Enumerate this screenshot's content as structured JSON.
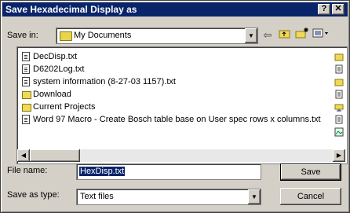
{
  "dialog": {
    "title": "Save Hexadecimal Display as",
    "help_glyph": "?",
    "close_glyph": "✕"
  },
  "save_in": {
    "label": "Save in:",
    "value": "My Documents"
  },
  "toolbar": {
    "back_icon": "back-arrow-icon",
    "up_icon": "up-folder-icon",
    "new_folder_icon": "new-folder-icon",
    "views_icon": "views-menu-icon"
  },
  "files": [
    {
      "name": "DecDisp.txt",
      "type": "file"
    },
    {
      "name": "D6202Log.txt",
      "type": "file"
    },
    {
      "name": "system information (8-27-03 1157).txt",
      "type": "file"
    },
    {
      "name": "Download",
      "type": "folder"
    },
    {
      "name": "Current Projects",
      "type": "folder"
    },
    {
      "name": "Word 97 Macro - Create Bosch table base on User spec rows x columns.txt",
      "type": "file"
    }
  ],
  "file_name": {
    "label": "File name:",
    "value": "HexDisp.txt"
  },
  "save_as_type": {
    "label": "Save as type:",
    "value": "Text files"
  },
  "buttons": {
    "save": "Save",
    "cancel": "Cancel"
  },
  "colors": {
    "titlebar": "#0a246a",
    "face": "#d4d0c8",
    "selection": "#0a246a"
  }
}
